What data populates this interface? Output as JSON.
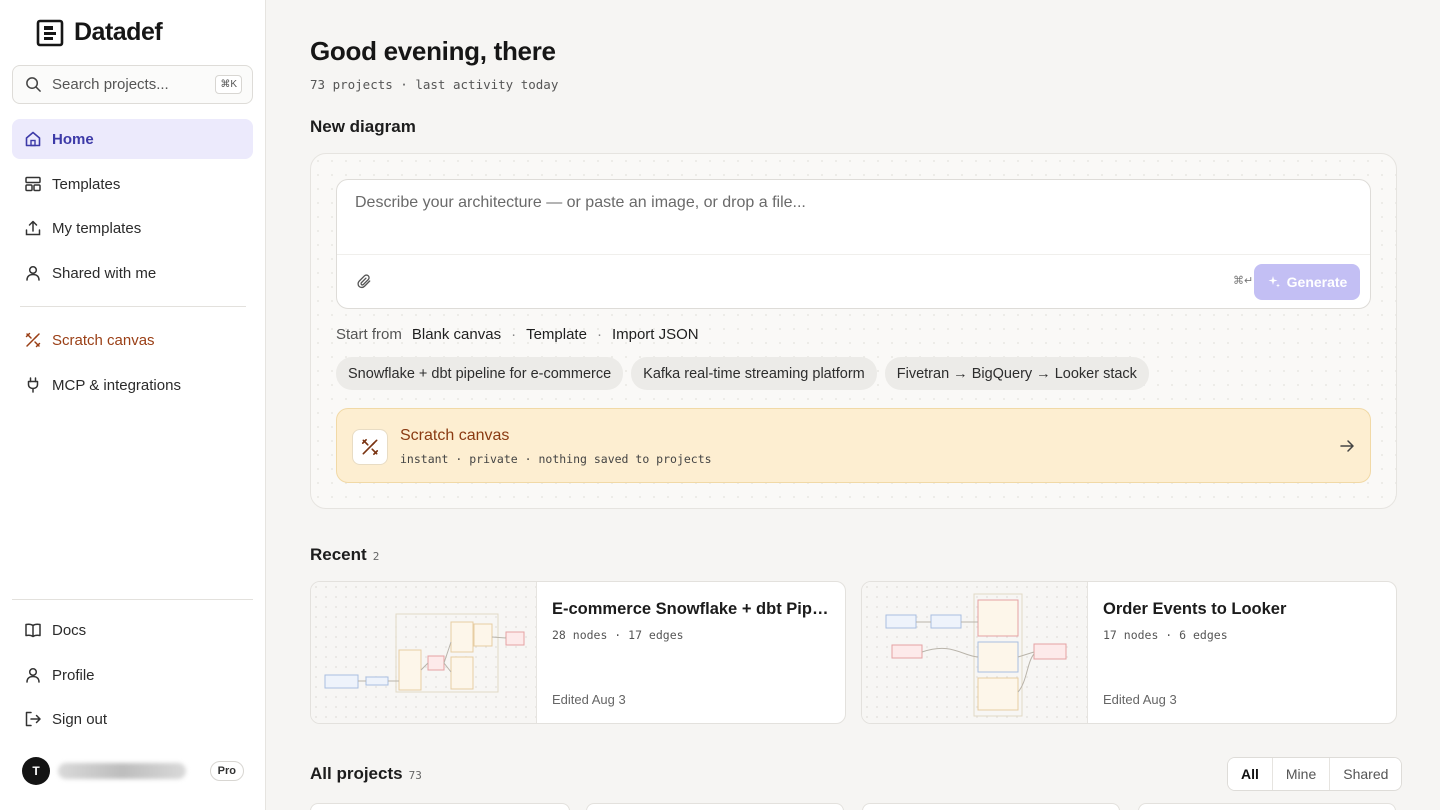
{
  "sidebar": {
    "brand": "Datadef",
    "search_placeholder": "Search projects...",
    "search_shortcut": "⌘K",
    "nav": [
      {
        "label": "Home"
      },
      {
        "label": "Templates"
      },
      {
        "label": "My templates"
      },
      {
        "label": "Shared with me"
      },
      {
        "label": "Scratch canvas"
      },
      {
        "label": "MCP & integrations"
      }
    ],
    "bottom_nav": [
      {
        "label": "Docs"
      },
      {
        "label": "Profile"
      },
      {
        "label": "Sign out"
      }
    ],
    "user": {
      "initial": "T",
      "plan": "Pro"
    }
  },
  "header": {
    "greeting": "Good evening, there",
    "subline": "73 projects · last activity today"
  },
  "new_diagram": {
    "title": "New diagram",
    "prompt_placeholder": "Describe your architecture — or paste an image, or drop a file...",
    "enter_hint": "⌘↵",
    "generate_label": "Generate",
    "start_from_label": "Start from",
    "start_options": [
      "Blank canvas",
      "Template",
      "Import JSON"
    ],
    "suggestions": [
      "Snowflake + dbt pipeline for e-commerce",
      "Kafka real-time streaming platform",
      "Fivetran → BigQuery → Looker stack"
    ],
    "scratch": {
      "title": "Scratch canvas",
      "subtitle": "instant · private · nothing saved to projects"
    }
  },
  "recent": {
    "title": "Recent",
    "count": "2",
    "cards": [
      {
        "title": "E-commerce Snowflake + dbt Pipeline",
        "meta": "28 nodes · 17 edges",
        "edited": "Edited Aug 3"
      },
      {
        "title": "Order Events to Looker",
        "meta": "17 nodes · 6 edges",
        "edited": "Edited Aug 3"
      }
    ]
  },
  "all_projects": {
    "title": "All projects",
    "count": "73",
    "filters": [
      "All",
      "Mine",
      "Shared"
    ]
  },
  "colors": {
    "accent": "#3d3aa8",
    "active_bg": "#eceafc",
    "generate_bg": "#c3bff4",
    "scratch_bg": "#fdeed1",
    "scratch_text": "#8a3a12"
  }
}
